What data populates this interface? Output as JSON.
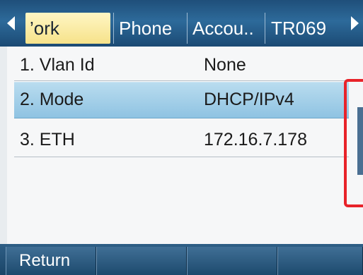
{
  "tabs": [
    {
      "label": "’ork",
      "active": true
    },
    {
      "label": "Phone",
      "active": false
    },
    {
      "label": "Accou..",
      "active": false
    },
    {
      "label": "TR069",
      "active": false
    }
  ],
  "rows": [
    {
      "label": "1. Vlan Id",
      "value": "None",
      "selected": false
    },
    {
      "label": "2. Mode",
      "value": "DHCP/IPv4",
      "selected": true
    },
    {
      "label": "3. ETH",
      "value": "172.16.7.178",
      "selected": false
    }
  ],
  "softkeys": [
    {
      "label": "Return"
    },
    {
      "label": ""
    },
    {
      "label": ""
    },
    {
      "label": ""
    }
  ],
  "colors": {
    "header": "#2d6a9a",
    "active_tab": "#f6e28a",
    "selected_row": "#8fc3e2",
    "annotation": "#e8232a"
  },
  "icons": {
    "left_arrow": "triangle-left",
    "right_arrow": "triangle-right"
  }
}
